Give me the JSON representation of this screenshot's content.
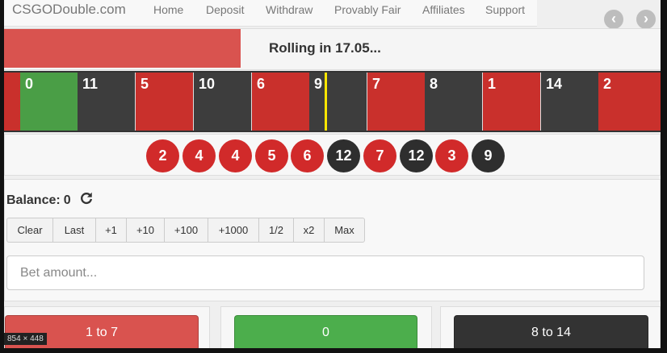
{
  "nav": {
    "brand": "CSGODouble.com",
    "items": [
      {
        "label": "Home"
      },
      {
        "label": "Deposit"
      },
      {
        "label": "Withdraw"
      },
      {
        "label": "Provably Fair"
      },
      {
        "label": "Affiliates"
      },
      {
        "label": "Support"
      }
    ]
  },
  "status": {
    "rolling_text": "Rolling in 17.05...",
    "rolling_fraction": 0.36
  },
  "wheel": {
    "cells": [
      {
        "number": "0",
        "color": "green"
      },
      {
        "number": "11",
        "color": "black"
      },
      {
        "number": "5",
        "color": "red"
      },
      {
        "number": "10",
        "color": "black"
      },
      {
        "number": "6",
        "color": "red"
      },
      {
        "number": "9",
        "color": "black"
      },
      {
        "number": "7",
        "color": "red"
      },
      {
        "number": "8",
        "color": "black"
      },
      {
        "number": "1",
        "color": "red"
      },
      {
        "number": "14",
        "color": "black"
      },
      {
        "number": "2",
        "color": "red"
      }
    ]
  },
  "history": [
    {
      "number": "2",
      "color": "red"
    },
    {
      "number": "4",
      "color": "red"
    },
    {
      "number": "4",
      "color": "red"
    },
    {
      "number": "5",
      "color": "red"
    },
    {
      "number": "6",
      "color": "red"
    },
    {
      "number": "12",
      "color": "black"
    },
    {
      "number": "7",
      "color": "red"
    },
    {
      "number": "12",
      "color": "black"
    },
    {
      "number": "3",
      "color": "red"
    },
    {
      "number": "9",
      "color": "black"
    }
  ],
  "balance": {
    "label": "Balance:",
    "value": "0"
  },
  "quick_buttons": [
    "Clear",
    "Last",
    "+1",
    "+10",
    "+100",
    "+1000",
    "1/2",
    "x2",
    "Max"
  ],
  "bet_input": {
    "placeholder": "Bet amount...",
    "value": ""
  },
  "bet_buttons": [
    {
      "label": "1 to 7",
      "color": "#d9534f"
    },
    {
      "label": "0",
      "color": "#4cae4c"
    },
    {
      "label": "8 to 14",
      "color": "#333333"
    }
  ],
  "controls": {
    "prev_icon": "‹",
    "next_icon": "›"
  },
  "overlay": {
    "dimensions_text": "854 × 448"
  },
  "colors": {
    "red": "#c9302c",
    "black": "#3d3d3d",
    "green": "#4a9e46",
    "marker": "#ffe600"
  }
}
